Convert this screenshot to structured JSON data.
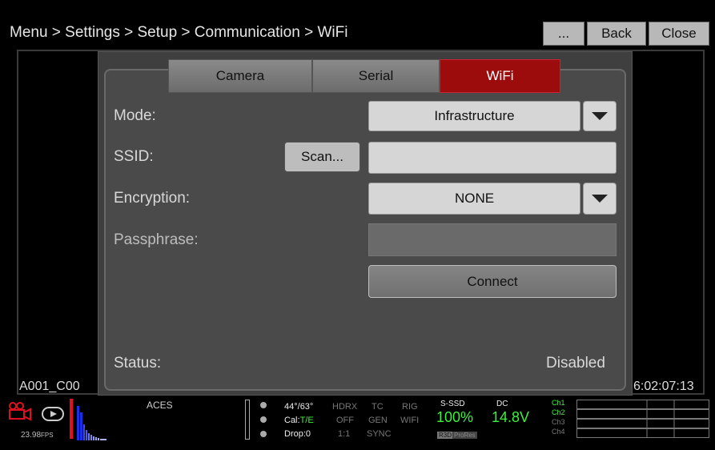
{
  "header": {
    "breadcrumb": "Menu > Settings > Setup > Communication > WiFi",
    "more_label": "...",
    "back_label": "Back",
    "close_label": "Close"
  },
  "tabs": [
    {
      "label": "Camera",
      "active": false
    },
    {
      "label": "Serial",
      "active": false
    },
    {
      "label": "WiFi",
      "active": true
    }
  ],
  "form": {
    "mode_label": "Mode:",
    "mode_value": "Infrastructure",
    "ssid_label": "SSID:",
    "scan_label": "Scan...",
    "ssid_value": "",
    "encryption_label": "Encryption:",
    "encryption_value": "NONE",
    "passphrase_label": "Passphrase:",
    "passphrase_value": "",
    "connect_label": "Connect",
    "status_label": "Status:",
    "status_value": "Disabled"
  },
  "viewport": {
    "clip_name": "A001_C00",
    "timecode": "6:02:07:13"
  },
  "statusbar": {
    "fps_value": "23.98",
    "fps_unit": "FPS",
    "color_space": "ACES",
    "temp": "44°/63°",
    "cal_label": "Cal:",
    "cal_value": "T/E",
    "drop": "Drop:0",
    "hdrx": "HDRX",
    "hdrx_state": "OFF",
    "hdrx_ratio": "1:1",
    "tc": "TC",
    "tc_state": "GEN",
    "tc_sync": "SYNC",
    "rig": "RIG",
    "rig_wifi": "WIFI",
    "media_label": "S-SSD",
    "media_value": "100%",
    "r3d": "R3D",
    "prores": "ProRes",
    "power_label": "DC",
    "power_value": "14.8V",
    "channels": [
      "Ch1",
      "Ch2",
      "Ch3",
      "Ch4"
    ]
  },
  "colors": {
    "accent_red": "#9c0c0c",
    "green": "#3df03d"
  }
}
